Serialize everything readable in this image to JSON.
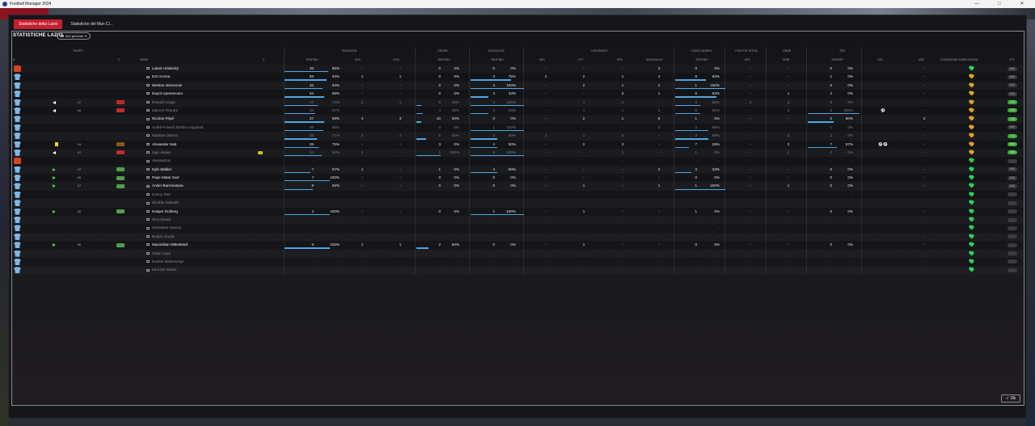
{
  "window": {
    "title": "Football Manager 2024",
    "minimize": "—",
    "maximize": "□",
    "close": "✕"
  },
  "tabs": [
    {
      "label": "Statistiche della Lazio",
      "active": true
    },
    {
      "label": "Statistiche del Man Ci..."
    }
  ],
  "panel": {
    "title": "STATISTICHE LAZIO",
    "info_button": "Info generali",
    "ok_button": "Ok"
  },
  "groups": {
    "tempo": "TEMPO",
    "passaggi": "PASSAGGI",
    "cross": "CROSS",
    "scivolate": "SCIVOLATE",
    "contrasti": "CONTRASTI",
    "gioco_aereo": "GIOCO AEREO",
    "colpi_testa": "COLPI DI TESTA",
    "gare": "GARE",
    "tiri": "TIRI"
  },
  "columns": {
    "n": "N",
    "c": "C",
    "nome": "NOME",
    "c2": "C",
    "tent_riu_pass": "TENT/RIU",
    "dec": "DEC",
    "occ": "OCN",
    "tent_riu_cross": "TENT/RIU",
    "tent_riu_sciv": "TENT/RIU",
    "dec2": "DEC",
    "vtt": "VTT",
    "rec": "REC",
    "salvataggi": "SALVATAGGI",
    "tent_riu_aereo": "TENT/RIU",
    "dec3": "DEC",
    "drib": "DRIB",
    "tent_nsp": "TNT/NSP",
    "gol": "GOL",
    "ass": "ASS",
    "condizione": "CONDIZIONE COMPLESSIVA",
    "vot": "VOT"
  },
  "players": [
    {
      "name": "Lukas Hrádecký",
      "shirt": "gk",
      "pass": "26",
      "pass_pct": "96%",
      "dec": "-",
      "occ": "-",
      "cross": "0",
      "cross_pct": "0%",
      "sciv": "0",
      "sciv_pct": "0%",
      "dec2": "-",
      "vtt": "-",
      "rec": "-",
      "salv": "3",
      "aereo": "0",
      "aereo_pct": "0%",
      "dec3": "-",
      "drib": "-",
      "tiri": "0",
      "tiri_pct": "0%",
      "gol": "",
      "ass": "-",
      "heart": "green",
      "vot": "6.5"
    },
    {
      "name": "Ezri Konsa",
      "pass": "59",
      "pass_pct": "93%",
      "dec": "1",
      "occ": "1",
      "cross": "0",
      "cross_pct": "0%",
      "sciv": "4",
      "sciv_pct": "75%",
      "dec2": "2",
      "vtt": "2",
      "rec": "1",
      "salv": "4",
      "aereo": "8",
      "aereo_pct": "62%",
      "dec3": "-",
      "drib": "-",
      "tiri": "1",
      "tiri_pct": "0%",
      "gol": "",
      "ass": "-",
      "heart": "orange",
      "vot": "6.6"
    },
    {
      "name": "Weston McKennie",
      "pass": "32",
      "pass_pct": "84%",
      "dec": "-",
      "occ": "-",
      "cross": "0",
      "cross_pct": "0%",
      "sciv": "3",
      "sciv_pct": "100%",
      "dec2": "-",
      "vtt": "2",
      "rec": "1",
      "salv": "2",
      "aereo": "1",
      "aereo_pct": "100%",
      "dec3": "-",
      "drib": "-",
      "tiri": "0",
      "tiri_pct": "0%",
      "gol": "",
      "ass": "-",
      "heart": "orange",
      "vot": "6.2"
    },
    {
      "name": "Dayot Upamecano",
      "pass": "54",
      "pass_pct": "88%",
      "dec": "-",
      "occ": "-",
      "cross": "0",
      "cross_pct": "0%",
      "sciv": "3",
      "sciv_pct": "33%",
      "dec2": "-",
      "vtt": "-",
      "rec": "3",
      "salv": "1",
      "aereo": "6",
      "aereo_pct": "83%",
      "dec3": "-",
      "drib": "1",
      "tiri": "2",
      "tiri_pct": "0%",
      "gol": "",
      "ass": "-",
      "heart": "orange",
      "vot": "6.3"
    },
    {
      "name": "Ronald Araujo",
      "dim": true,
      "off": true,
      "min": "47",
      "chip": "red",
      "pass": "27",
      "pass_pct": "74%",
      "dec": "2",
      "occ": "1",
      "cross": "5",
      "cross_pct": "20%",
      "sciv": "3",
      "sciv_pct": "100%",
      "dec2": "-",
      "vtt": "1",
      "rec": "2",
      "salv": "-",
      "aereo": "6",
      "aereo_pct": "50%",
      "dec3": "2",
      "drib": "4",
      "tiri": "0",
      "tiri_pct": "0%",
      "gol": "",
      "ass": "-",
      "heart": "orange",
      "vot": "7.0",
      "good": true
    },
    {
      "name": "Marcus Thuram",
      "dim": true,
      "off": true,
      "min": "60",
      "chip": "red",
      "pass": "34",
      "pass_pct": "67%",
      "dec": "-",
      "occ": "-",
      "cross": "4",
      "cross_pct": "25%",
      "sciv": "3",
      "sciv_pct": "33%",
      "dec2": "-",
      "vtt": "1",
      "rec": "1",
      "salv": "3",
      "aereo": "6",
      "aereo_pct": "50%",
      "dec3": "-",
      "drib": "2",
      "tiri": "2",
      "tiri_pct": "100%",
      "gol": "⚽",
      "ass": "-",
      "heart": "orange",
      "vot": "7.5",
      "good": true
    },
    {
      "name": "Nicolas Pépé",
      "pass": "27",
      "pass_pct": "88%",
      "dec": "4",
      "occ": "3",
      "cross": "10",
      "cross_pct": "20%",
      "sciv": "0",
      "sciv_pct": "0%",
      "dec2": "-",
      "vtt": "2",
      "rec": "1",
      "salv": "6",
      "aereo": "1",
      "aereo_pct": "0%",
      "dec3": "-",
      "drib": "-",
      "tiri": "2",
      "tiri_pct": "50%",
      "gol": "",
      "ass": "2",
      "heart": "orange",
      "vot": "7.3",
      "good": true
    },
    {
      "name": "André-Franck Zambo Anguissa",
      "dim": true,
      "pass": "48",
      "pass_pct": "85%",
      "dec": "-",
      "occ": "-",
      "cross": "0",
      "cross_pct": "0%",
      "sciv": "1",
      "sciv_pct": "100%",
      "dec2": "-",
      "vtt": "-",
      "rec": "-",
      "salv": "2",
      "aereo": "3",
      "aereo_pct": "66%",
      "dec3": "-",
      "drib": "-",
      "tiri": "1",
      "tiri_pct": "0%",
      "gol": "",
      "ass": "-",
      "heart": "orange",
      "vot": "6.9"
    },
    {
      "name": "Mathias Olivera",
      "dim": true,
      "pass": "28",
      "pass_pct": "71%",
      "dec": "2",
      "occ": "2",
      "cross": "5",
      "cross_pct": "40%",
      "sciv": "2",
      "sciv_pct": "50%",
      "dec2": "1",
      "vtt": "1",
      "rec": "5",
      "salv": "-",
      "aereo": "3",
      "aereo_pct": "66%",
      "dec3": "-",
      "drib": "2",
      "tiri": "2",
      "tiri_pct": "0%",
      "gol": "",
      "ass": "-",
      "heart": "orange",
      "vot": "7.1",
      "good": true
    },
    {
      "name": "Alexander Isak",
      "card": true,
      "min": "94",
      "chip": "brown",
      "pass": "29",
      "pass_pct": "75%",
      "dec": "-",
      "occ": "-",
      "cross": "3",
      "cross_pct": "0%",
      "sciv": "4",
      "sciv_pct": "50%",
      "dec2": "-",
      "vtt": "2",
      "rec": "3",
      "salv": "-",
      "aereo": "7",
      "aereo_pct": "28%",
      "dec3": "-",
      "drib": "3",
      "tiri": "7",
      "tiri_pct": "57%",
      "gol": "⚽⚽",
      "ass": "-",
      "heart": "orange",
      "vot": "8.0",
      "good": true
    },
    {
      "name": "Iago Aspas",
      "dim": true,
      "off": true,
      "min": "67",
      "chip": "red",
      "yellow": true,
      "pass": "24",
      "pass_pct": "83%",
      "dec": "2",
      "occ": "-",
      "cross": "1",
      "cross_pct": "100%",
      "sciv": "5",
      "sciv_pct": "100%",
      "dec2": "-",
      "vtt": "-",
      "rec": "1",
      "salv": "-",
      "aereo": "1",
      "aereo_pct": "0%",
      "dec3": "-",
      "drib": "2",
      "tiri": "0",
      "tiri_pct": "0%",
      "gol": "",
      "ass": "-",
      "heart": "orange",
      "vot": "6.8",
      "good": true
    },
    {
      "name": "Alexandros",
      "dim": true,
      "shirt": "gk",
      "pass": "-",
      "pass_pct": "-",
      "dec": "-",
      "occ": "-",
      "cross": "-",
      "cross_pct": "-",
      "sciv": "-",
      "sciv_pct": "-",
      "dec2": "-",
      "vtt": "-",
      "rec": "-",
      "salv": "-",
      "aereo": "-",
      "aereo_pct": "-",
      "dec3": "-",
      "drib": "-",
      "tiri": "-",
      "tiri_pct": "-",
      "gol": "",
      "ass": "-",
      "heart": "green",
      "vot": "-"
    },
    {
      "name": "Kyle Walker",
      "on": true,
      "min": "47",
      "chip": "green",
      "pass": "7",
      "pass_pct": "57%",
      "dec": "1",
      "occ": "-",
      "cross": "1",
      "cross_pct": "0%",
      "sciv": "4",
      "sciv_pct": "50%",
      "dec2": "-",
      "vtt": "-",
      "rec": "-",
      "salv": "2",
      "aereo": "3",
      "aereo_pct": "33%",
      "dec3": "-",
      "drib": "-",
      "tiri": "0",
      "tiri_pct": "0%",
      "gol": "",
      "ass": "-",
      "heart": "green",
      "vot": "6.6"
    },
    {
      "name": "Pape Matar Sarr",
      "on": true,
      "min": "60",
      "chip": "green",
      "pass": "7",
      "pass_pct": "100%",
      "dec": "-",
      "occ": "-",
      "cross": "0",
      "cross_pct": "0%",
      "sciv": "0",
      "sciv_pct": "0%",
      "dec2": "-",
      "vtt": "-",
      "rec": "-",
      "salv": "-",
      "aereo": "0",
      "aereo_pct": "0%",
      "dec3": "-",
      "drib": "-",
      "tiri": "0",
      "tiri_pct": "0%",
      "gol": "",
      "ass": "-",
      "heart": "green",
      "vot": "6.5"
    },
    {
      "name": "Ander Barrenetxea",
      "on": true,
      "min": "67",
      "chip": "green",
      "pass": "8",
      "pass_pct": "62%",
      "dec": "-",
      "occ": "-",
      "cross": "0",
      "cross_pct": "0%",
      "sciv": "0",
      "sciv_pct": "0%",
      "dec2": "-",
      "vtt": "1",
      "rec": "-",
      "salv": "1",
      "aereo": "1",
      "aereo_pct": "100%",
      "dec3": "-",
      "drib": "1",
      "tiri": "0",
      "tiri_pct": "0%",
      "gol": "",
      "ass": "-",
      "heart": "green",
      "vot": "6.6"
    },
    {
      "name": "Kenny Tete",
      "dim": true,
      "pass": "-",
      "pass_pct": "-",
      "dec": "-",
      "occ": "-",
      "cross": "-",
      "cross_pct": "-",
      "sciv": "-",
      "sciv_pct": "-",
      "dec2": "-",
      "vtt": "-",
      "rec": "-",
      "salv": "-",
      "aereo": "-",
      "aereo_pct": "-",
      "dec3": "-",
      "drib": "-",
      "tiri": "-",
      "tiri_pct": "-",
      "gol": "",
      "ass": "-",
      "heart": "green",
      "vot": "-"
    },
    {
      "name": "Nicolás Salvadó",
      "dim": true,
      "pass": "-",
      "pass_pct": "-",
      "dec": "-",
      "occ": "-",
      "cross": "-",
      "cross_pct": "-",
      "sciv": "-",
      "sciv_pct": "-",
      "dec2": "-",
      "vtt": "-",
      "rec": "-",
      "salv": "-",
      "aereo": "-",
      "aereo_pct": "-",
      "dec3": "-",
      "drib": "-",
      "tiri": "-",
      "tiri_pct": "-",
      "gol": "",
      "ass": "-",
      "heart": "green",
      "vot": "-"
    },
    {
      "name": "Kasper Dolberg",
      "on": true,
      "min": "80",
      "chip": "green",
      "pass": "2",
      "pass_pct": "100%",
      "dec": "-",
      "occ": "-",
      "cross": "0",
      "cross_pct": "0%",
      "sciv": "1",
      "sciv_pct": "100%",
      "dec2": "-",
      "vtt": "1",
      "rec": "-",
      "salv": "-",
      "aereo": "1",
      "aereo_pct": "0%",
      "dec3": "-",
      "drib": "-",
      "tiri": "0",
      "tiri_pct": "0%",
      "gol": "",
      "ass": "-",
      "heart": "green",
      "vot": "-"
    },
    {
      "name": "Nico Elvedi",
      "dim": true,
      "pass": "-",
      "pass_pct": "-",
      "dec": "-",
      "occ": "-",
      "cross": "-",
      "cross_pct": "-",
      "sciv": "-",
      "sciv_pct": "-",
      "dec2": "-",
      "vtt": "-",
      "rec": "-",
      "salv": "-",
      "aereo": "-",
      "aereo_pct": "-",
      "dec3": "-",
      "drib": "-",
      "tiri": "-",
      "tiri_pct": "-",
      "gol": "",
      "ass": "-",
      "heart": "green",
      "vot": "-"
    },
    {
      "name": "Sebastian Nanasi",
      "dim": true,
      "pass": "-",
      "pass_pct": "-",
      "dec": "-",
      "occ": "-",
      "cross": "-",
      "cross_pct": "-",
      "sciv": "-",
      "sciv_pct": "-",
      "dec2": "-",
      "vtt": "-",
      "rec": "-",
      "salv": "-",
      "aereo": "-",
      "aereo_pct": "-",
      "dec3": "-",
      "drib": "-",
      "tiri": "-",
      "tiri_pct": "-",
      "gol": "",
      "ass": "-",
      "heart": "green",
      "vot": "-"
    },
    {
      "name": "Brajan Gruda",
      "dim": true,
      "pass": "-",
      "pass_pct": "-",
      "dec": "-",
      "occ": "-",
      "cross": "-",
      "cross_pct": "-",
      "sciv": "-",
      "sciv_pct": "-",
      "dec2": "-",
      "vtt": "-",
      "rec": "-",
      "salv": "-",
      "aereo": "-",
      "aereo_pct": "-",
      "dec3": "-",
      "drib": "-",
      "tiri": "-",
      "tiri_pct": "-",
      "gol": "",
      "ass": "-",
      "heart": "green",
      "vot": "-"
    },
    {
      "name": "Maximilian Mittelstädt",
      "on": true,
      "min": "80",
      "chip": "green",
      "pass": "6",
      "pass_pct": "100%",
      "dec": "1",
      "occ": "1",
      "cross": "2",
      "cross_pct": "50%",
      "sciv": "0",
      "sciv_pct": "0%",
      "dec2": "-",
      "vtt": "1",
      "rec": "-",
      "salv": "-",
      "aereo": "0",
      "aereo_pct": "0%",
      "dec3": "-",
      "drib": "-",
      "tiri": "0",
      "tiri_pct": "0%",
      "gol": "",
      "ass": "-",
      "heart": "green",
      "vot": "-"
    },
    {
      "name": "Taisin Ayari",
      "dim": true,
      "pass": "-",
      "pass_pct": "-",
      "dec": "-",
      "occ": "-",
      "cross": "-",
      "cross_pct": "-",
      "sciv": "-",
      "sciv_pct": "-",
      "dec2": "-",
      "vtt": "-",
      "rec": "-",
      "salv": "-",
      "aereo": "-",
      "aereo_pct": "-",
      "dec3": "-",
      "drib": "-",
      "tiri": "-",
      "tiri_pct": "-",
      "gol": "",
      "ass": "-",
      "heart": "green",
      "vot": "-"
    },
    {
      "name": "Ruslan Malinovskyi",
      "dim": true,
      "pass": "-",
      "pass_pct": "-",
      "dec": "-",
      "occ": "-",
      "cross": "-",
      "cross_pct": "-",
      "sciv": "-",
      "sciv_pct": "-",
      "dec2": "-",
      "vtt": "-",
      "rec": "-",
      "salv": "-",
      "aereo": "-",
      "aereo_pct": "-",
      "dec3": "-",
      "drib": "-",
      "tiri": "-",
      "tiri_pct": "-",
      "gol": "",
      "ass": "-",
      "heart": "green",
      "vot": "-"
    },
    {
      "name": "Kimi De Winter",
      "dim": true,
      "pass": "-",
      "pass_pct": "-",
      "dec": "-",
      "occ": "-",
      "cross": "-",
      "cross_pct": "-",
      "sciv": "-",
      "sciv_pct": "-",
      "dec2": "-",
      "vtt": "-",
      "rec": "-",
      "salv": "-",
      "aereo": "-",
      "aereo_pct": "-",
      "dec3": "-",
      "drib": "-",
      "tiri": "-",
      "tiri_pct": "-",
      "gol": "",
      "ass": "-",
      "heart": "green",
      "vot": "-"
    }
  ]
}
